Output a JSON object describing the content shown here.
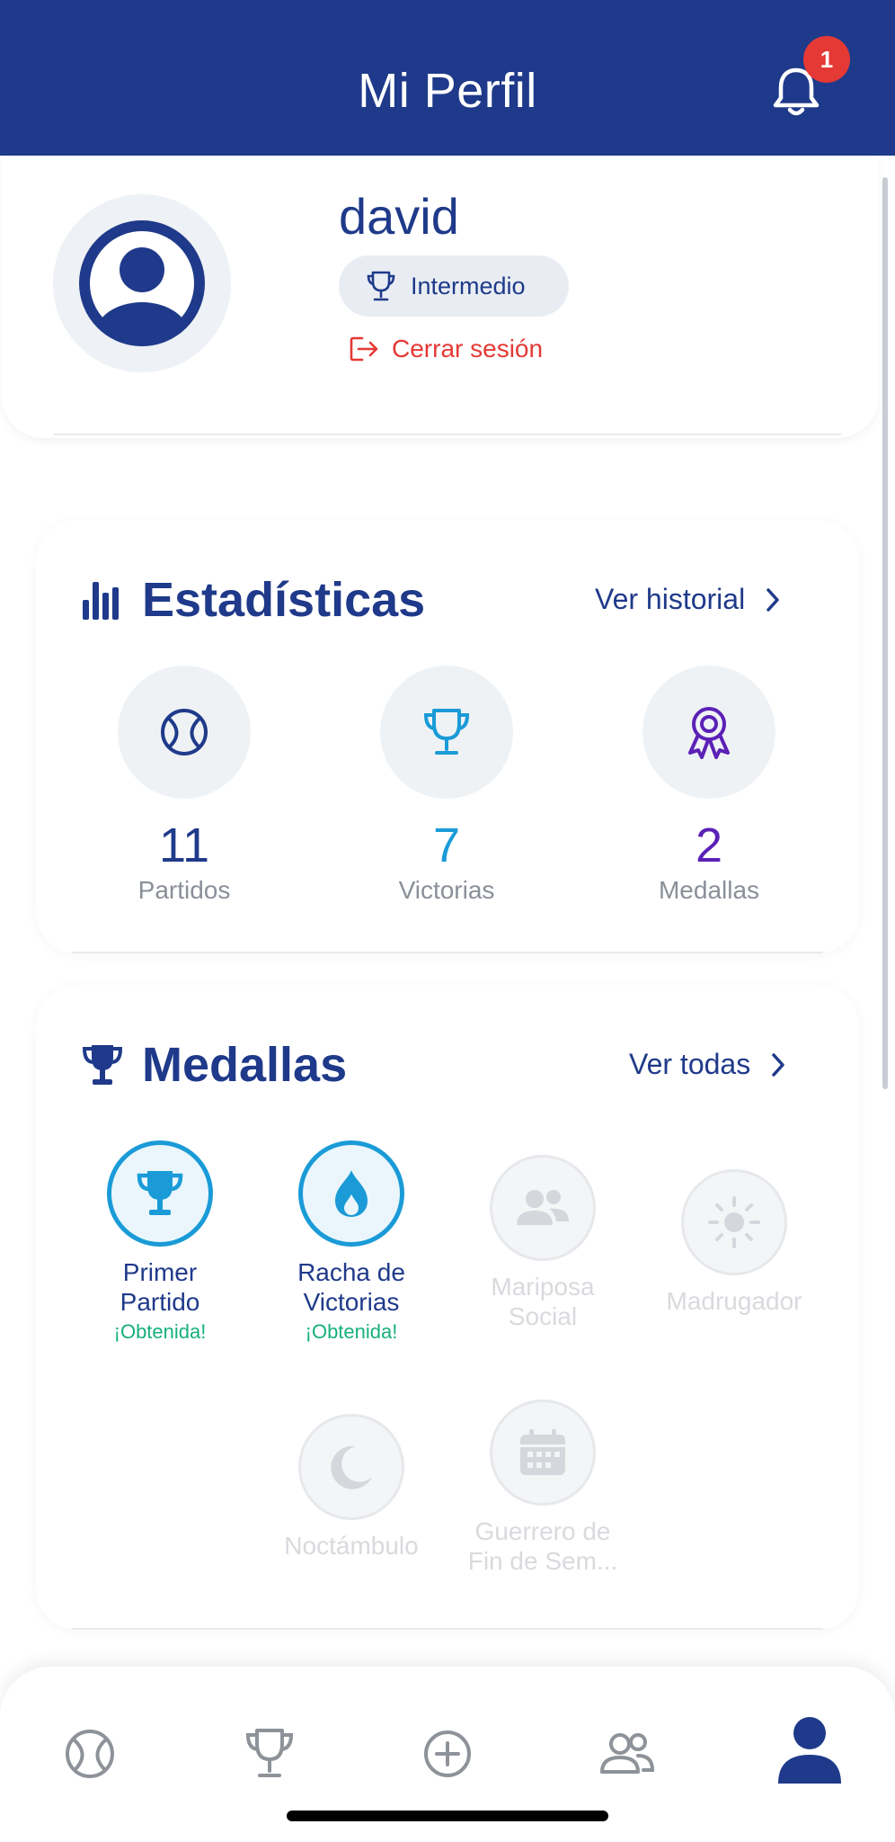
{
  "header": {
    "title": "Mi Perfil",
    "notification_count": "1"
  },
  "profile": {
    "username": "david",
    "level": "Intermedio",
    "logout_label": "Cerrar sesión"
  },
  "stats": {
    "title": "Estadísticas",
    "link_label": "Ver historial",
    "items": [
      {
        "value": "11",
        "label": "Partidos",
        "color": "#1f3a8a",
        "icon": "tennis-ball-icon"
      },
      {
        "value": "7",
        "label": "Victorias",
        "color": "#1a9bd7",
        "icon": "trophy-icon"
      },
      {
        "value": "2",
        "label": "Medallas",
        "color": "#5b21b6",
        "icon": "award-ribbon-icon"
      }
    ]
  },
  "medals": {
    "title": "Medallas",
    "link_label": "Ver todas",
    "items": [
      {
        "name_line1": "Primer",
        "name_line2": "Partido",
        "status": "¡Obtenida!",
        "earned": true,
        "icon": "trophy-icon"
      },
      {
        "name_line1": "Racha de",
        "name_line2": "Victorias",
        "status": "¡Obtenida!",
        "earned": true,
        "icon": "flame-icon"
      },
      {
        "name_line1": "Mariposa",
        "name_line2": "Social",
        "earned": false,
        "icon": "people-icon"
      },
      {
        "name_line1": "Madrugador",
        "name_line2": "",
        "earned": false,
        "icon": "sun-icon"
      },
      {
        "name_line1": "Noctámbulo",
        "name_line2": "",
        "earned": false,
        "icon": "moon-icon"
      },
      {
        "name_line1": "Guerrero de",
        "name_line2": "Fin de Sem...",
        "earned": false,
        "icon": "calendar-icon"
      }
    ]
  },
  "bottom_nav": {
    "items": [
      "tennis-ball-icon",
      "trophy-icon",
      "plus-circle-icon",
      "people-icon",
      "person-icon"
    ],
    "active": "person-icon"
  },
  "colors": {
    "primary": "#1f3a8a",
    "accent": "#1a9bd7",
    "danger": "#e53935",
    "success": "#16b07a",
    "purple": "#5b21b6"
  }
}
